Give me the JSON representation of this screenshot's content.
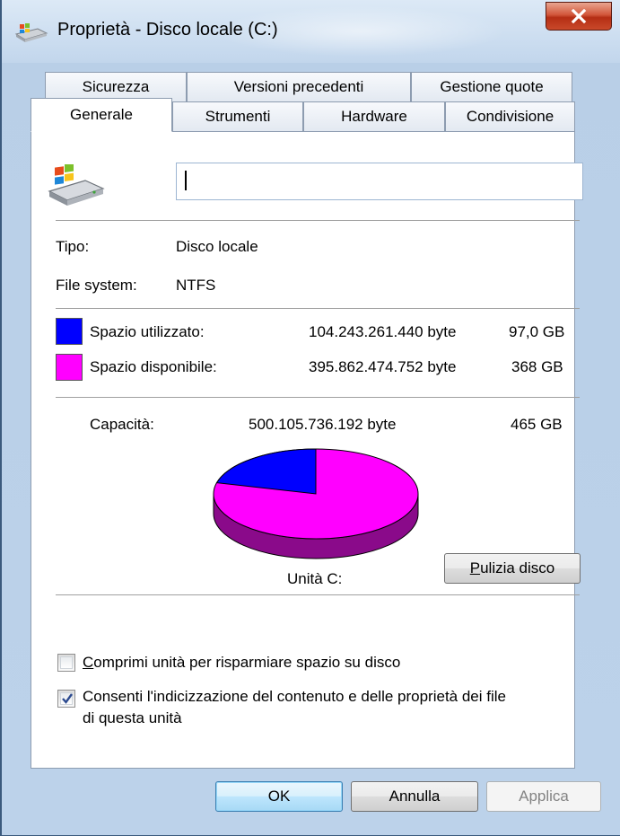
{
  "window": {
    "title": "Proprietà - Disco locale (C:)"
  },
  "tabs": {
    "row_back": [
      "Sicurezza",
      "Versioni precedenti",
      "Gestione quote"
    ],
    "row_front": [
      "Generale",
      "Strumenti",
      "Hardware",
      "Condivisione"
    ],
    "active": "Generale"
  },
  "general": {
    "name_value": "",
    "type_label": "Tipo:",
    "type_value": "Disco locale",
    "fs_label": "File system:",
    "fs_value": "NTFS",
    "used": {
      "label": "Spazio utilizzato:",
      "bytes": "104.243.261.440 byte",
      "size": "97,0 GB",
      "color": "#0000ff"
    },
    "free": {
      "label": "Spazio disponibile:",
      "bytes": "395.862.474.752 byte",
      "size": "368 GB",
      "color": "#ff00ff"
    },
    "capacity": {
      "label": "Capacità:",
      "bytes": "500.105.736.192 byte",
      "size": "465 GB"
    },
    "drive_label": "Unità C:",
    "cleanup_button": {
      "prefix": "",
      "underline": "P",
      "rest": "ulizia disco"
    },
    "compress": {
      "checked": false,
      "label_prefix": "",
      "label_underline": "C",
      "label_rest": "omprimi unità per risparmiare spazio su disco"
    },
    "index": {
      "checked": true,
      "line1": "Consenti l'indicizzazione del contenuto e delle proprietà dei file",
      "line2": "di questa unità"
    }
  },
  "buttons": {
    "ok": "OK",
    "cancel": "Annulla",
    "apply": "Applica"
  },
  "usage_fraction_used": 0.21
}
